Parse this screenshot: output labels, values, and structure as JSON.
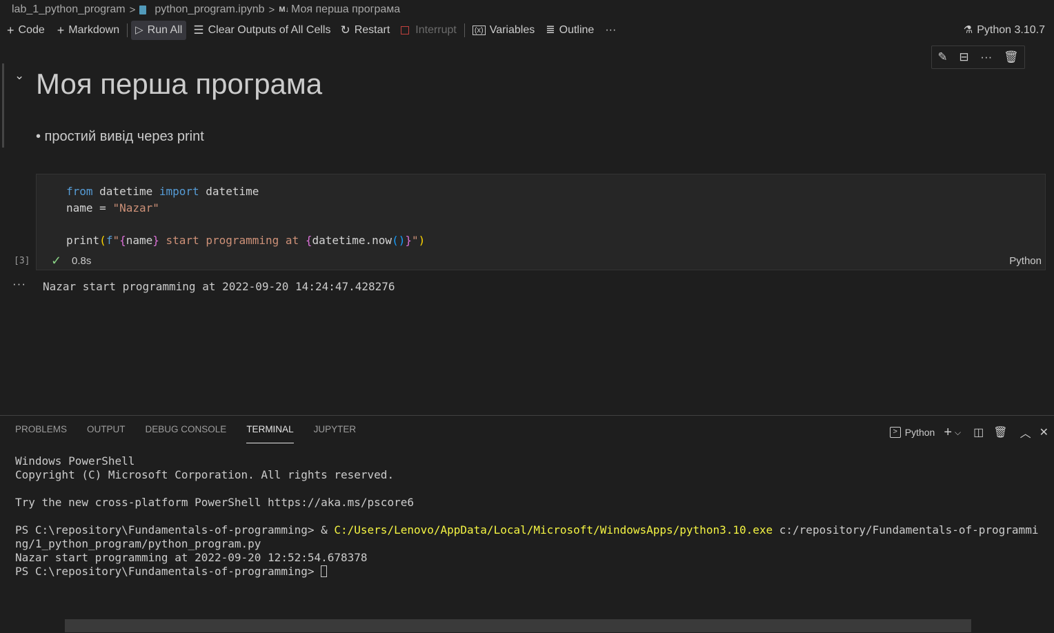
{
  "breadcrumb": {
    "folder": "lab_1_python_program",
    "file": "python_program.ipynb",
    "md_badge": "M↓",
    "section": "Моя перша програма"
  },
  "toolbar": {
    "code": "Code",
    "markdown": "Markdown",
    "run_all": "Run All",
    "clear_outputs": "Clear Outputs of All Cells",
    "restart": "Restart",
    "interrupt": "Interrupt",
    "variables": "Variables",
    "outline": "Outline",
    "more": "···",
    "kernel": "Python 3.10.7"
  },
  "markdown_cell": {
    "heading": "Моя перша програма",
    "bullet": "• простий вивід через print"
  },
  "code_cell": {
    "exec_count": "[3]",
    "duration": "0.8s",
    "language": "Python",
    "output": "Nazar start programming at 2022-09-20 14:24:47.428276"
  },
  "panel": {
    "tabs": [
      "PROBLEMS",
      "OUTPUT",
      "DEBUG CONSOLE",
      "TERMINAL",
      "JUPYTER"
    ],
    "terminal_profile": "Python"
  },
  "terminal": {
    "line1": "Windows PowerShell",
    "line2": "Copyright (C) Microsoft Corporation. All rights reserved.",
    "line3": "Try the new cross-platform PowerShell https://aka.ms/pscore6",
    "prompt": "PS C:\\repository\\Fundamentals-of-programming> ",
    "cmd_amp": "& ",
    "cmd_exe": "C:/Users/Lenovo/AppData/Local/Microsoft/WindowsApps/python3.10.exe",
    "cmd_arg": " c:/repository/Fundamentals-of-programmi",
    "cmd_arg_wrap": "ng/1_python_program/python_program.py",
    "result": "Nazar start programming at 2022-09-20 12:52:54.678378",
    "prompt2": "PS C:\\repository\\Fundamentals-of-programming> "
  },
  "colors": {
    "background": "#1e1e1e",
    "keyword": "#569cd6",
    "string": "#ce9178",
    "success": "#89d185",
    "terminal_exe": "#f5f543"
  }
}
